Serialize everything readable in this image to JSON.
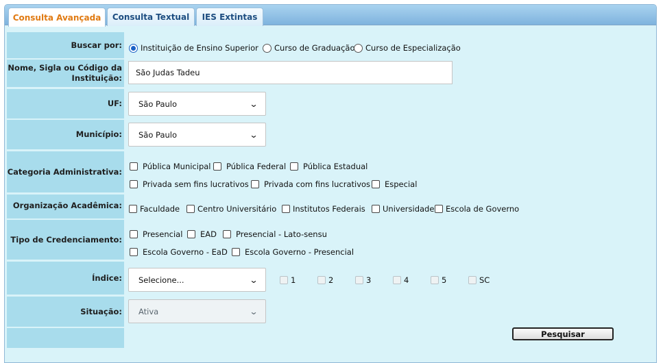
{
  "tabs": [
    "Consulta Avançada",
    "Consulta Textual",
    "IES Extintas"
  ],
  "form": {
    "buscar": {
      "label": "Buscar por:",
      "options": [
        "Instituição de Ensino Superior",
        "Curso de Graduação",
        "Curso de Especialização"
      ],
      "selected": "Instituição de Ensino Superior"
    },
    "nome": {
      "label_line1": "Nome, Sigla ou Código da",
      "label_line2": "Instituição:",
      "value": "São Judas Tadeu"
    },
    "uf": {
      "label": "UF:",
      "value": "São Paulo"
    },
    "municipio": {
      "label": "Município:",
      "value": "São Paulo"
    },
    "categoria": {
      "label": "Categoria Administrativa:",
      "options": [
        "Pública Municipal",
        "Pública Federal",
        "Pública Estadual",
        "Privada sem fins lucrativos",
        "Privada com fins lucrativos",
        "Especial"
      ]
    },
    "organizacao": {
      "label": "Organização Acadêmica:",
      "options": [
        "Faculdade",
        "Centro Universitário",
        "Institutos Federais",
        "Universidade",
        "Escola de Governo"
      ]
    },
    "credenciamento": {
      "label": "Tipo de Credenciamento:",
      "options": [
        "Presencial",
        "EAD",
        "Presencial - Lato-sensu",
        "Escola Governo - EaD",
        "Escola Governo - Presencial"
      ]
    },
    "indice": {
      "label": "Índice:",
      "value": "Selecione...",
      "checks": [
        "1",
        "2",
        "3",
        "4",
        "5",
        "SC"
      ]
    },
    "situacao": {
      "label": "Situação:",
      "value": "Ativa"
    },
    "submit": "Pesquisar"
  },
  "colors": {
    "panel": "#d9f3f9",
    "label_bg": "#a8dcec",
    "active_tab": "#e07a12",
    "tab_text": "#1d4d80"
  }
}
